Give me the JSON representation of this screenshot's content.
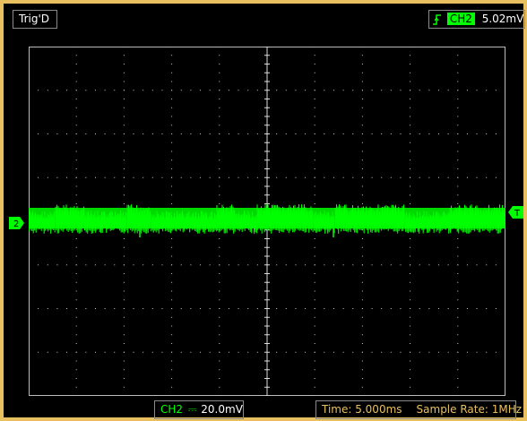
{
  "header": {
    "trigger_status": "Trig'D",
    "trigger_channel": "CH2",
    "trigger_level": "5.02mV",
    "trigger_edge_icon": "rising-edge-icon"
  },
  "footer": {
    "channel": "CH2",
    "coupling_icon": "dc-coupling-icon",
    "coupling_symbol": "⎓",
    "volts_div": "20.0mV",
    "time_div": "Time: 5.000ms",
    "sample_rate": "Sample Rate: 1MHz"
  },
  "markers": {
    "channel_marker": "2",
    "trigger_marker": "T"
  },
  "colors": {
    "frame": "#e8c060",
    "trace": "#00ff00",
    "grid": "#c8c8c8",
    "panel_text": "#ffffff"
  }
}
